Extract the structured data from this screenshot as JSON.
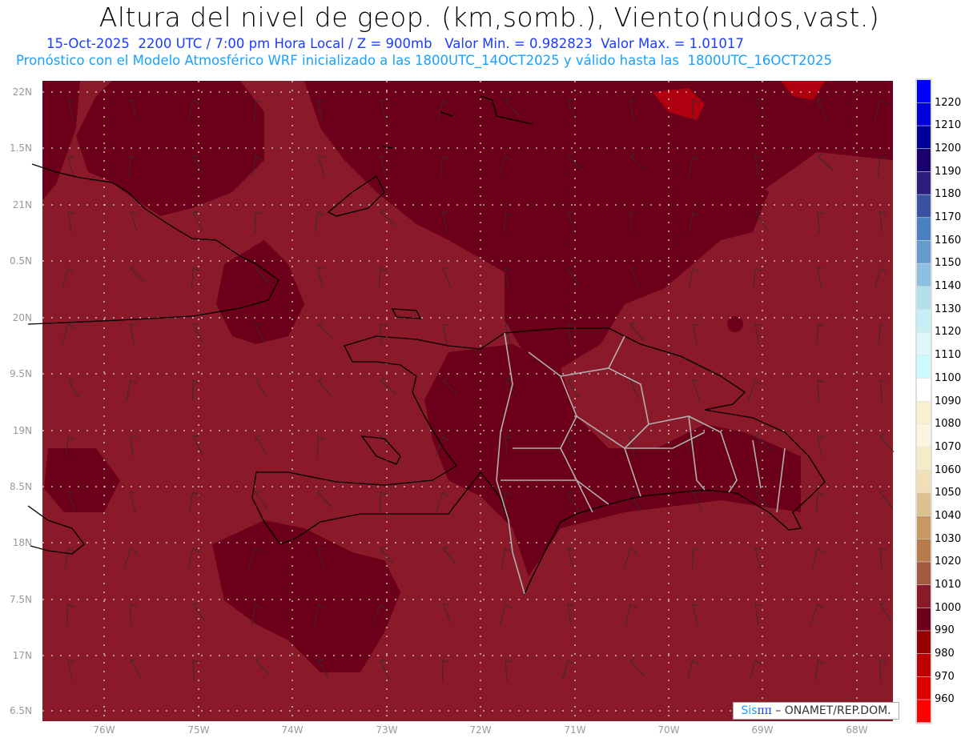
{
  "header": {
    "title": "Altura del nivel de geop. (km,somb.), Viento(nudos,vast.)",
    "subtitle": "15-Oct-2025  2200 UTC / 7:00 pm Hora Local / Z = 900mb   Valor Min. = 0.982823  Valor Max. = 1.01017",
    "model_info": "Pronóstico con el Modelo Atmosférico WRF inicializado a las 1800UTC_14OCT2025 y válido hasta las  1800UTC_16OCT2025"
  },
  "map": {
    "lon_labels": [
      "76W",
      "75W",
      "74W",
      "73W",
      "72W",
      "71W",
      "70W",
      "69W",
      "68W"
    ],
    "lat_labels": [
      "22N",
      "1.5N",
      "21N",
      "0.5N",
      "20N",
      "9.5N",
      "19N",
      "8.5N",
      "18N",
      "7.5N",
      "17N",
      "6.5N"
    ],
    "colors": {
      "field_light": "#8a1a29",
      "field_dark": "#6c001a",
      "grid": "#d8d8d8",
      "coast": "#000000",
      "borders": "#b0b0b0",
      "barb": "#3a2a2a"
    }
  },
  "colorbar": {
    "labels": [
      "1220",
      "1210",
      "1200",
      "1190",
      "1180",
      "1170",
      "1160",
      "1150",
      "1140",
      "1130",
      "1120",
      "1110",
      "1100",
      "1090",
      "1080",
      "1070",
      "1060",
      "1050",
      "1040",
      "1030",
      "1020",
      "1010",
      "1000",
      "990",
      "980",
      "970",
      "960"
    ],
    "colors": [
      "#0000ff",
      "#0000dc",
      "#000098",
      "#1a006c",
      "#2a1e7c",
      "#3a52a0",
      "#4a80bf",
      "#6699cc",
      "#8cc0de",
      "#b3dfec",
      "#c6eef5",
      "#dff6fa",
      "#ccfaff",
      "#ffffff",
      "#f8f0d0",
      "#faf4e2",
      "#f5ebc8",
      "#efe0b8",
      "#dcc190",
      "#c89862",
      "#b87c4c",
      "#a05a40",
      "#8a1a29",
      "#6c001a",
      "#960000",
      "#bd0000",
      "#dd0000",
      "#ff0000"
    ]
  },
  "credit": {
    "sis": "Sis",
    "pi": "ππ",
    "text": "– ONAMET/REP.DOM."
  }
}
